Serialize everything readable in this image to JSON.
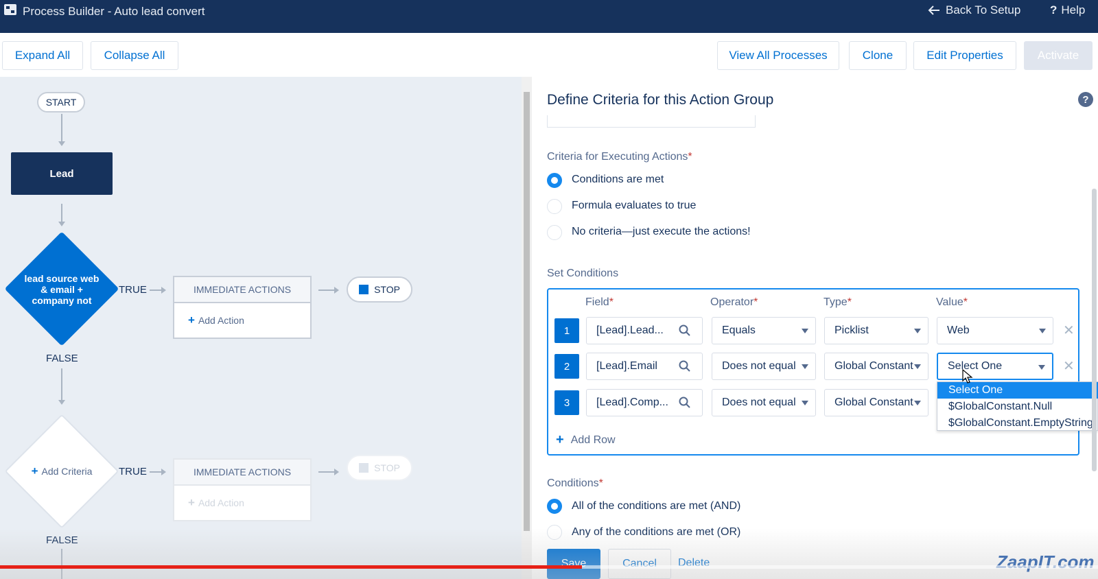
{
  "topbar": {
    "title": "Process Builder - Auto lead convert",
    "back_label": "Back To Setup",
    "help_label": "Help"
  },
  "toolbar": {
    "expand_all": "Expand All",
    "collapse_all": "Collapse All",
    "view_all_processes": "View All Processes",
    "clone": "Clone",
    "edit_properties": "Edit Properties",
    "activate": "Activate"
  },
  "canvas": {
    "start": "START",
    "object_node": "Lead",
    "criteria_1": "lead source web & email + company not",
    "true_label": "TRUE",
    "false_label": "FALSE",
    "immediate_actions": "IMMEDIATE ACTIONS",
    "add_action": "Add Action",
    "stop": "STOP",
    "add_criteria": "Add Criteria"
  },
  "panel": {
    "title": "Define Criteria for this Action Group",
    "criteria_label": "Criteria for Executing Actions",
    "criteria_options": [
      {
        "label": "Conditions are met",
        "checked": true
      },
      {
        "label": "Formula evaluates to true",
        "checked": false
      },
      {
        "label": "No criteria—just execute the actions!",
        "checked": false
      }
    ],
    "set_conditions_label": "Set Conditions",
    "columns": {
      "field": "Field",
      "operator": "Operator",
      "type": "Type",
      "value": "Value"
    },
    "rows": [
      {
        "num": "1",
        "field": "[Lead].Lead...",
        "operator": "Equals",
        "type": "Picklist",
        "value": "Web"
      },
      {
        "num": "2",
        "field": "[Lead].Email",
        "operator": "Does not equal",
        "type": "Global Constant",
        "value": "Select One"
      },
      {
        "num": "3",
        "field": "[Lead].Comp...",
        "operator": "Does not equal",
        "type": "Global Constant",
        "value": ""
      }
    ],
    "dropdown_options": [
      "Select One",
      "$GlobalConstant.Null",
      "$GlobalConstant.EmptyString"
    ],
    "add_row": "Add Row",
    "conditions_label": "Conditions",
    "condition_logic": [
      {
        "label": "All of the conditions are met (AND)",
        "checked": true
      },
      {
        "label": "Any of the conditions are met (OR)",
        "checked": false
      }
    ],
    "save": "Save",
    "cancel": "Cancel",
    "delete": "Delete"
  },
  "watermark": "ZaapIT.com",
  "video_progress_percent": 53,
  "colors": {
    "header": "#16325c",
    "accent": "#0070d2",
    "focus": "#1589ee",
    "progress": "#e62117"
  }
}
